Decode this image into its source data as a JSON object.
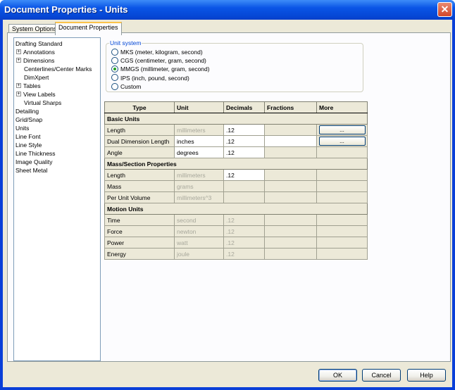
{
  "window": {
    "title": "Document Properties - Units",
    "close_symbol": "✕"
  },
  "tabs": [
    {
      "label": "System Options",
      "active": false
    },
    {
      "label": "Document Properties",
      "active": true
    }
  ],
  "tree": [
    {
      "label": "Drafting Standard",
      "level": 0,
      "expander": ""
    },
    {
      "label": "Annotations",
      "level": 1,
      "expander": "+"
    },
    {
      "label": "Dimensions",
      "level": 1,
      "expander": "+"
    },
    {
      "label": "Centerlines/Center Marks",
      "level": 2,
      "expander": ""
    },
    {
      "label": "DimXpert",
      "level": 2,
      "expander": ""
    },
    {
      "label": "Tables",
      "level": 1,
      "expander": "+"
    },
    {
      "label": "View Labels",
      "level": 1,
      "expander": "+"
    },
    {
      "label": "Virtual Sharps",
      "level": 2,
      "expander": ""
    },
    {
      "label": "Detailing",
      "level": 0,
      "expander": ""
    },
    {
      "label": "Grid/Snap",
      "level": 0,
      "expander": ""
    },
    {
      "label": "Units",
      "level": 0,
      "expander": ""
    },
    {
      "label": "Line Font",
      "level": 0,
      "expander": ""
    },
    {
      "label": "Line Style",
      "level": 0,
      "expander": ""
    },
    {
      "label": "Line Thickness",
      "level": 0,
      "expander": ""
    },
    {
      "label": "Image Quality",
      "level": 0,
      "expander": ""
    },
    {
      "label": "Sheet Metal",
      "level": 0,
      "expander": ""
    }
  ],
  "unit_system": {
    "title": "Unit system",
    "options": [
      {
        "label": "MKS  (meter, kilogram, second)",
        "checked": false
      },
      {
        "label": "CGS  (centimeter, gram, second)",
        "checked": false
      },
      {
        "label": "MMGS (millimeter, gram, second)",
        "checked": true
      },
      {
        "label": "IPS  (inch, pound, second)",
        "checked": false
      },
      {
        "label": "Custom",
        "checked": false
      }
    ]
  },
  "grid": {
    "headers": [
      "Type",
      "Unit",
      "Decimals",
      "Fractions",
      "More"
    ],
    "sections": [
      {
        "title": "Basic Units",
        "rows": [
          {
            "type": "Length",
            "unit": "millimeters",
            "unit_gray": true,
            "decimals": ".12",
            "decimals_gray": false,
            "decimals_edit": true,
            "fractions_edit": false,
            "more": "..."
          },
          {
            "type": "Dual Dimension Length",
            "unit": "inches",
            "unit_gray": false,
            "decimals": ".12",
            "decimals_gray": false,
            "decimals_edit": true,
            "fractions_edit": true,
            "more": "..."
          },
          {
            "type": "Angle",
            "unit": "degrees",
            "unit_gray": false,
            "decimals": ".12",
            "decimals_gray": false,
            "decimals_edit": true,
            "fractions_edit": false,
            "more": ""
          }
        ]
      },
      {
        "title": "Mass/Section Properties",
        "rows": [
          {
            "type": "Length",
            "unit": "millimeters",
            "unit_gray": true,
            "decimals": ".12",
            "decimals_gray": false,
            "decimals_edit": true,
            "fractions_edit": false,
            "more": ""
          },
          {
            "type": "Mass",
            "unit": "grams",
            "unit_gray": true,
            "decimals": "",
            "decimals_gray": false,
            "decimals_edit": false,
            "fractions_edit": false,
            "more": ""
          },
          {
            "type": "Per Unit Volume",
            "unit": "millimeters^3",
            "unit_gray": true,
            "decimals": "",
            "decimals_gray": false,
            "decimals_edit": false,
            "fractions_edit": false,
            "more": ""
          }
        ]
      },
      {
        "title": "Motion Units",
        "rows": [
          {
            "type": "Time",
            "unit": "second",
            "unit_gray": true,
            "decimals": ".12",
            "decimals_gray": true,
            "decimals_edit": false,
            "fractions_edit": false,
            "more": ""
          },
          {
            "type": "Force",
            "unit": "newton",
            "unit_gray": true,
            "decimals": ".12",
            "decimals_gray": true,
            "decimals_edit": false,
            "fractions_edit": false,
            "more": ""
          },
          {
            "type": "Power",
            "unit": "watt",
            "unit_gray": true,
            "decimals": ".12",
            "decimals_gray": true,
            "decimals_edit": false,
            "fractions_edit": false,
            "more": ""
          },
          {
            "type": "Energy",
            "unit": "joule",
            "unit_gray": true,
            "decimals": ".12",
            "decimals_gray": true,
            "decimals_edit": false,
            "fractions_edit": false,
            "more": ""
          }
        ]
      }
    ]
  },
  "buttons": {
    "ok": "OK",
    "cancel": "Cancel",
    "help": "Help"
  }
}
